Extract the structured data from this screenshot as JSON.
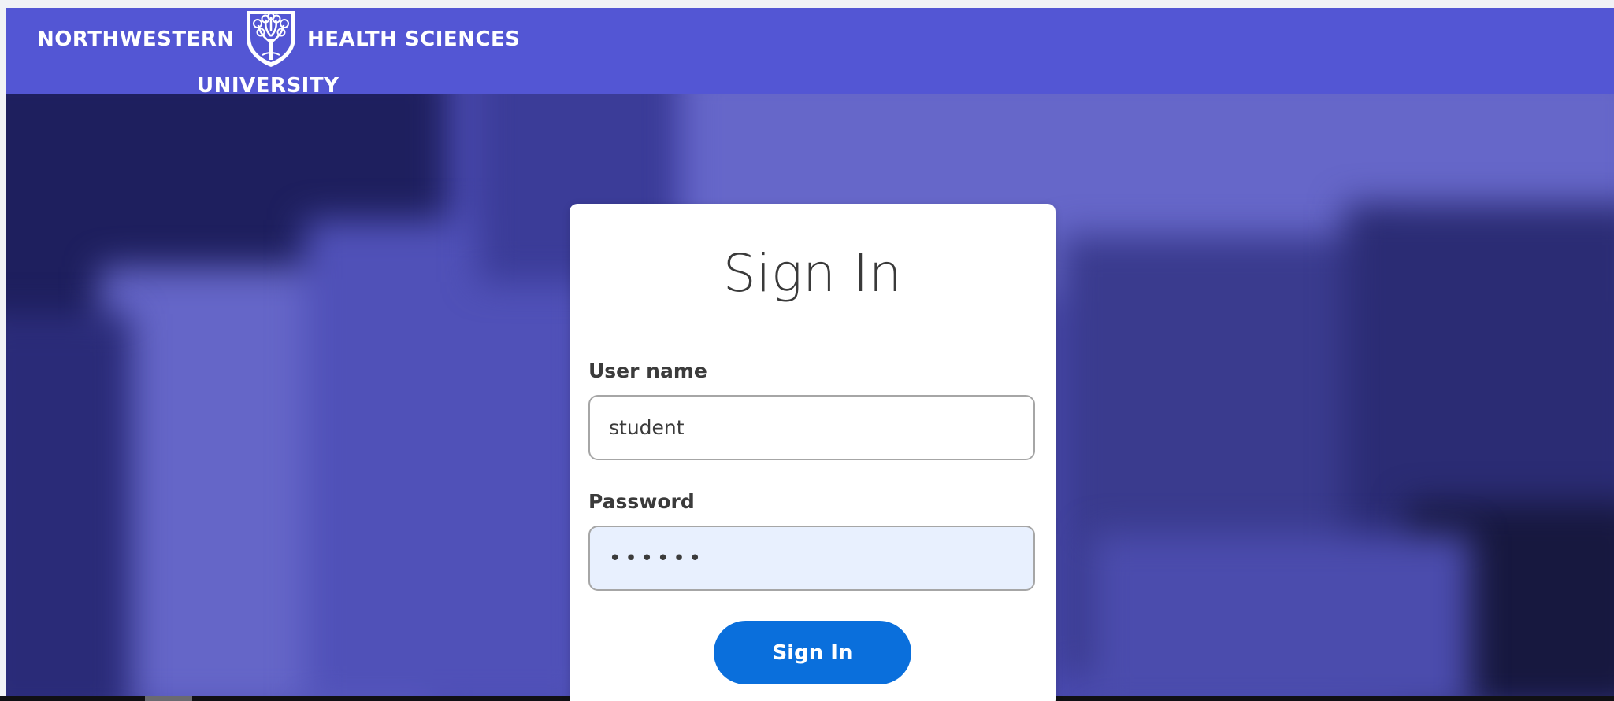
{
  "header": {
    "logo_left": "NORTHWESTERN",
    "logo_right": "HEALTH SCIENCES",
    "logo_bottom": "UNIVERSITY",
    "background_color": "#5356d4"
  },
  "sign_in": {
    "title": "Sign In",
    "username_label": "User name",
    "username_value": "student",
    "password_label": "Password",
    "password_value": "••••••",
    "button_label": "Sign In",
    "button_color": "#0a6fdc"
  },
  "icons": {
    "crest": "tree-shield-crest-icon"
  }
}
